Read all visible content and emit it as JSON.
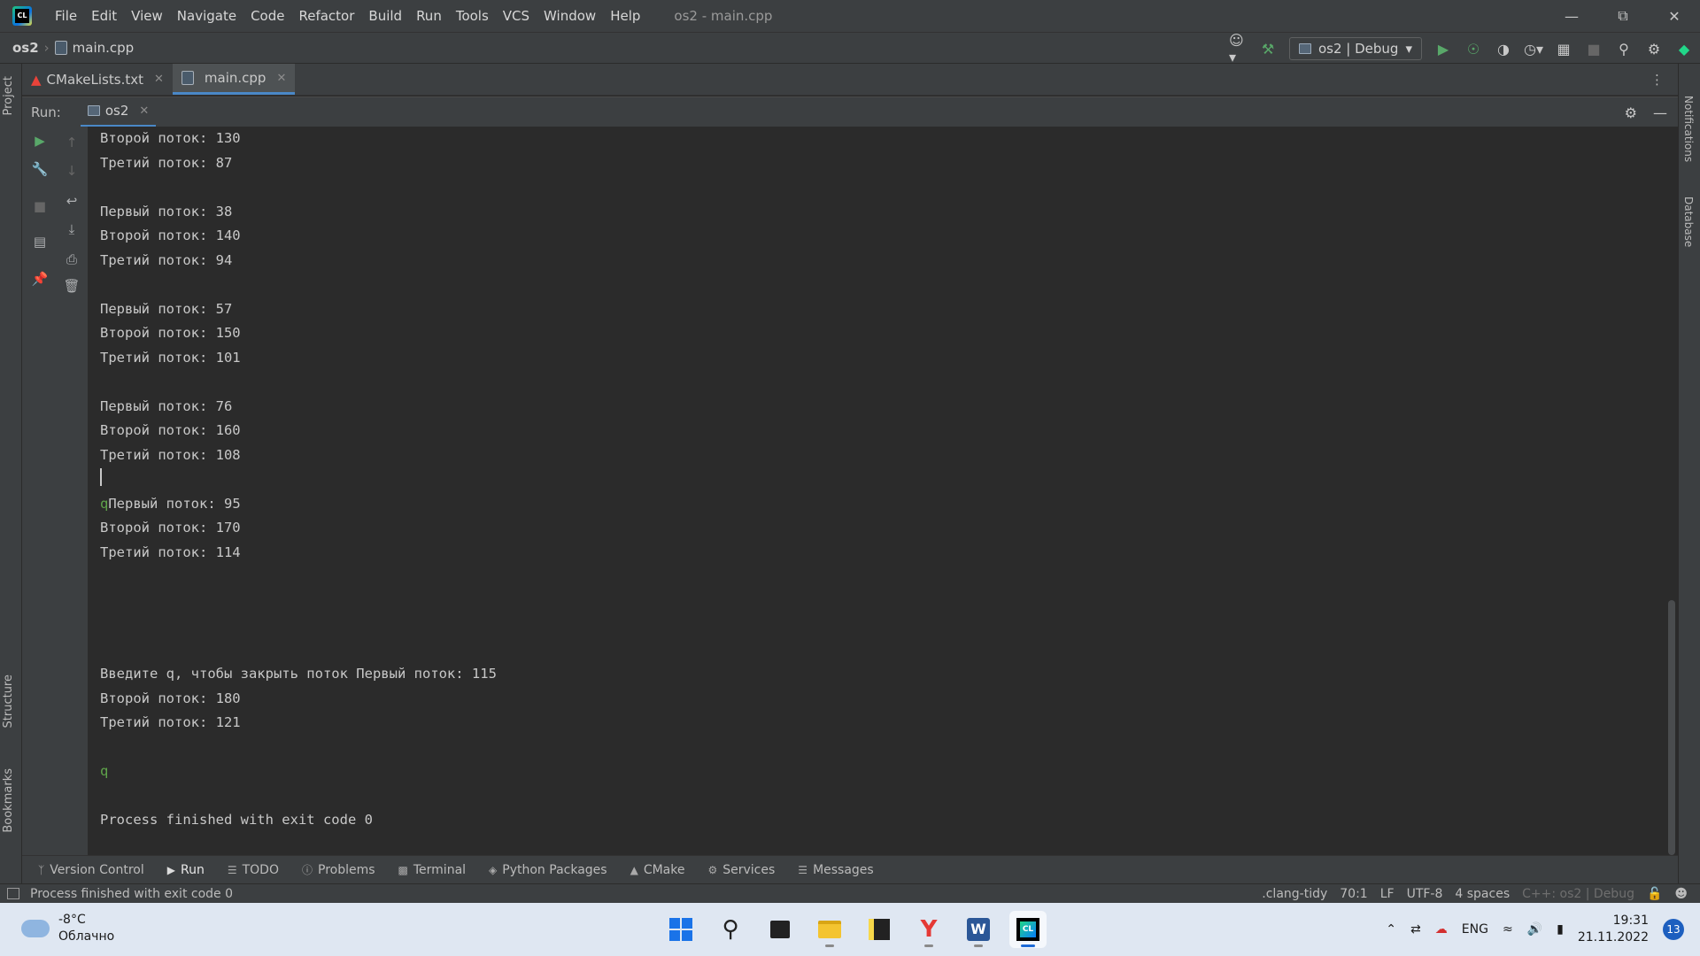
{
  "titlebar": {
    "menu": [
      "File",
      "Edit",
      "View",
      "Navigate",
      "Code",
      "Refactor",
      "Build",
      "Run",
      "Tools",
      "VCS",
      "Window",
      "Help"
    ],
    "title": "os2 - main.cpp",
    "app_logo_text": "CL"
  },
  "navbar": {
    "project": "os2",
    "file": "main.cpp",
    "run_config": "os2 | Debug"
  },
  "editor_tabs": [
    {
      "label": "CMakeLists.txt",
      "active": false
    },
    {
      "label": "main.cpp",
      "active": true
    }
  ],
  "left_strip": {
    "project": "Project",
    "structure": "Structure",
    "bookmarks": "Bookmarks"
  },
  "right_strip": {
    "notifications": "Notifications",
    "database": "Database"
  },
  "run_panel": {
    "label": "Run:",
    "tab": "os2"
  },
  "console": {
    "lines": [
      "Второй поток: 130",
      "Третий поток: 87",
      "",
      "Первый поток: 38",
      "Второй поток: 140",
      "Третий поток: 94",
      "",
      "Первый поток: 57",
      "Второй поток: 150",
      "Третий поток: 101",
      "",
      "Первый поток: 76",
      "Второй поток: 160",
      "Третий поток: 108",
      "",
      "Первый поток: 95",
      "Второй поток: 170",
      "Третий поток: 114",
      "",
      "",
      "",
      "",
      "Введите q, чтобы закрыть поток Первый поток: 115",
      "Второй поток: 180",
      "Третий поток: 121",
      "",
      "q",
      "",
      "Process finished with exit code 0"
    ],
    "input_echo": "q"
  },
  "bottom_tabs": [
    {
      "label": "Version Control",
      "icon": "branch-icon"
    },
    {
      "label": "Run",
      "icon": "play-icon"
    },
    {
      "label": "TODO",
      "icon": "list-icon"
    },
    {
      "label": "Problems",
      "icon": "problems-icon"
    },
    {
      "label": "Terminal",
      "icon": "terminal-icon"
    },
    {
      "label": "Python Packages",
      "icon": "packages-icon"
    },
    {
      "label": "CMake",
      "icon": "cmake-icon"
    },
    {
      "label": "Services",
      "icon": "services-icon"
    },
    {
      "label": "Messages",
      "icon": "messages-icon"
    }
  ],
  "statusbar": {
    "message": "Process finished with exit code 0",
    "clang_tidy": ".clang-tidy",
    "position": "70:1",
    "line_sep": "LF",
    "encoding": "UTF-8",
    "indent": "4 spaces",
    "context": "C++: os2 | Debug"
  },
  "taskbar": {
    "temperature": "-8°C",
    "weather": "Облачно",
    "lang": "ENG",
    "time": "19:31",
    "date": "21.11.2022",
    "notifications": "13"
  },
  "colors": {
    "accent": "#4a88c7",
    "run_green": "#59a869",
    "console_bg": "#2b2b2b",
    "panel_bg": "#3c3f41"
  }
}
